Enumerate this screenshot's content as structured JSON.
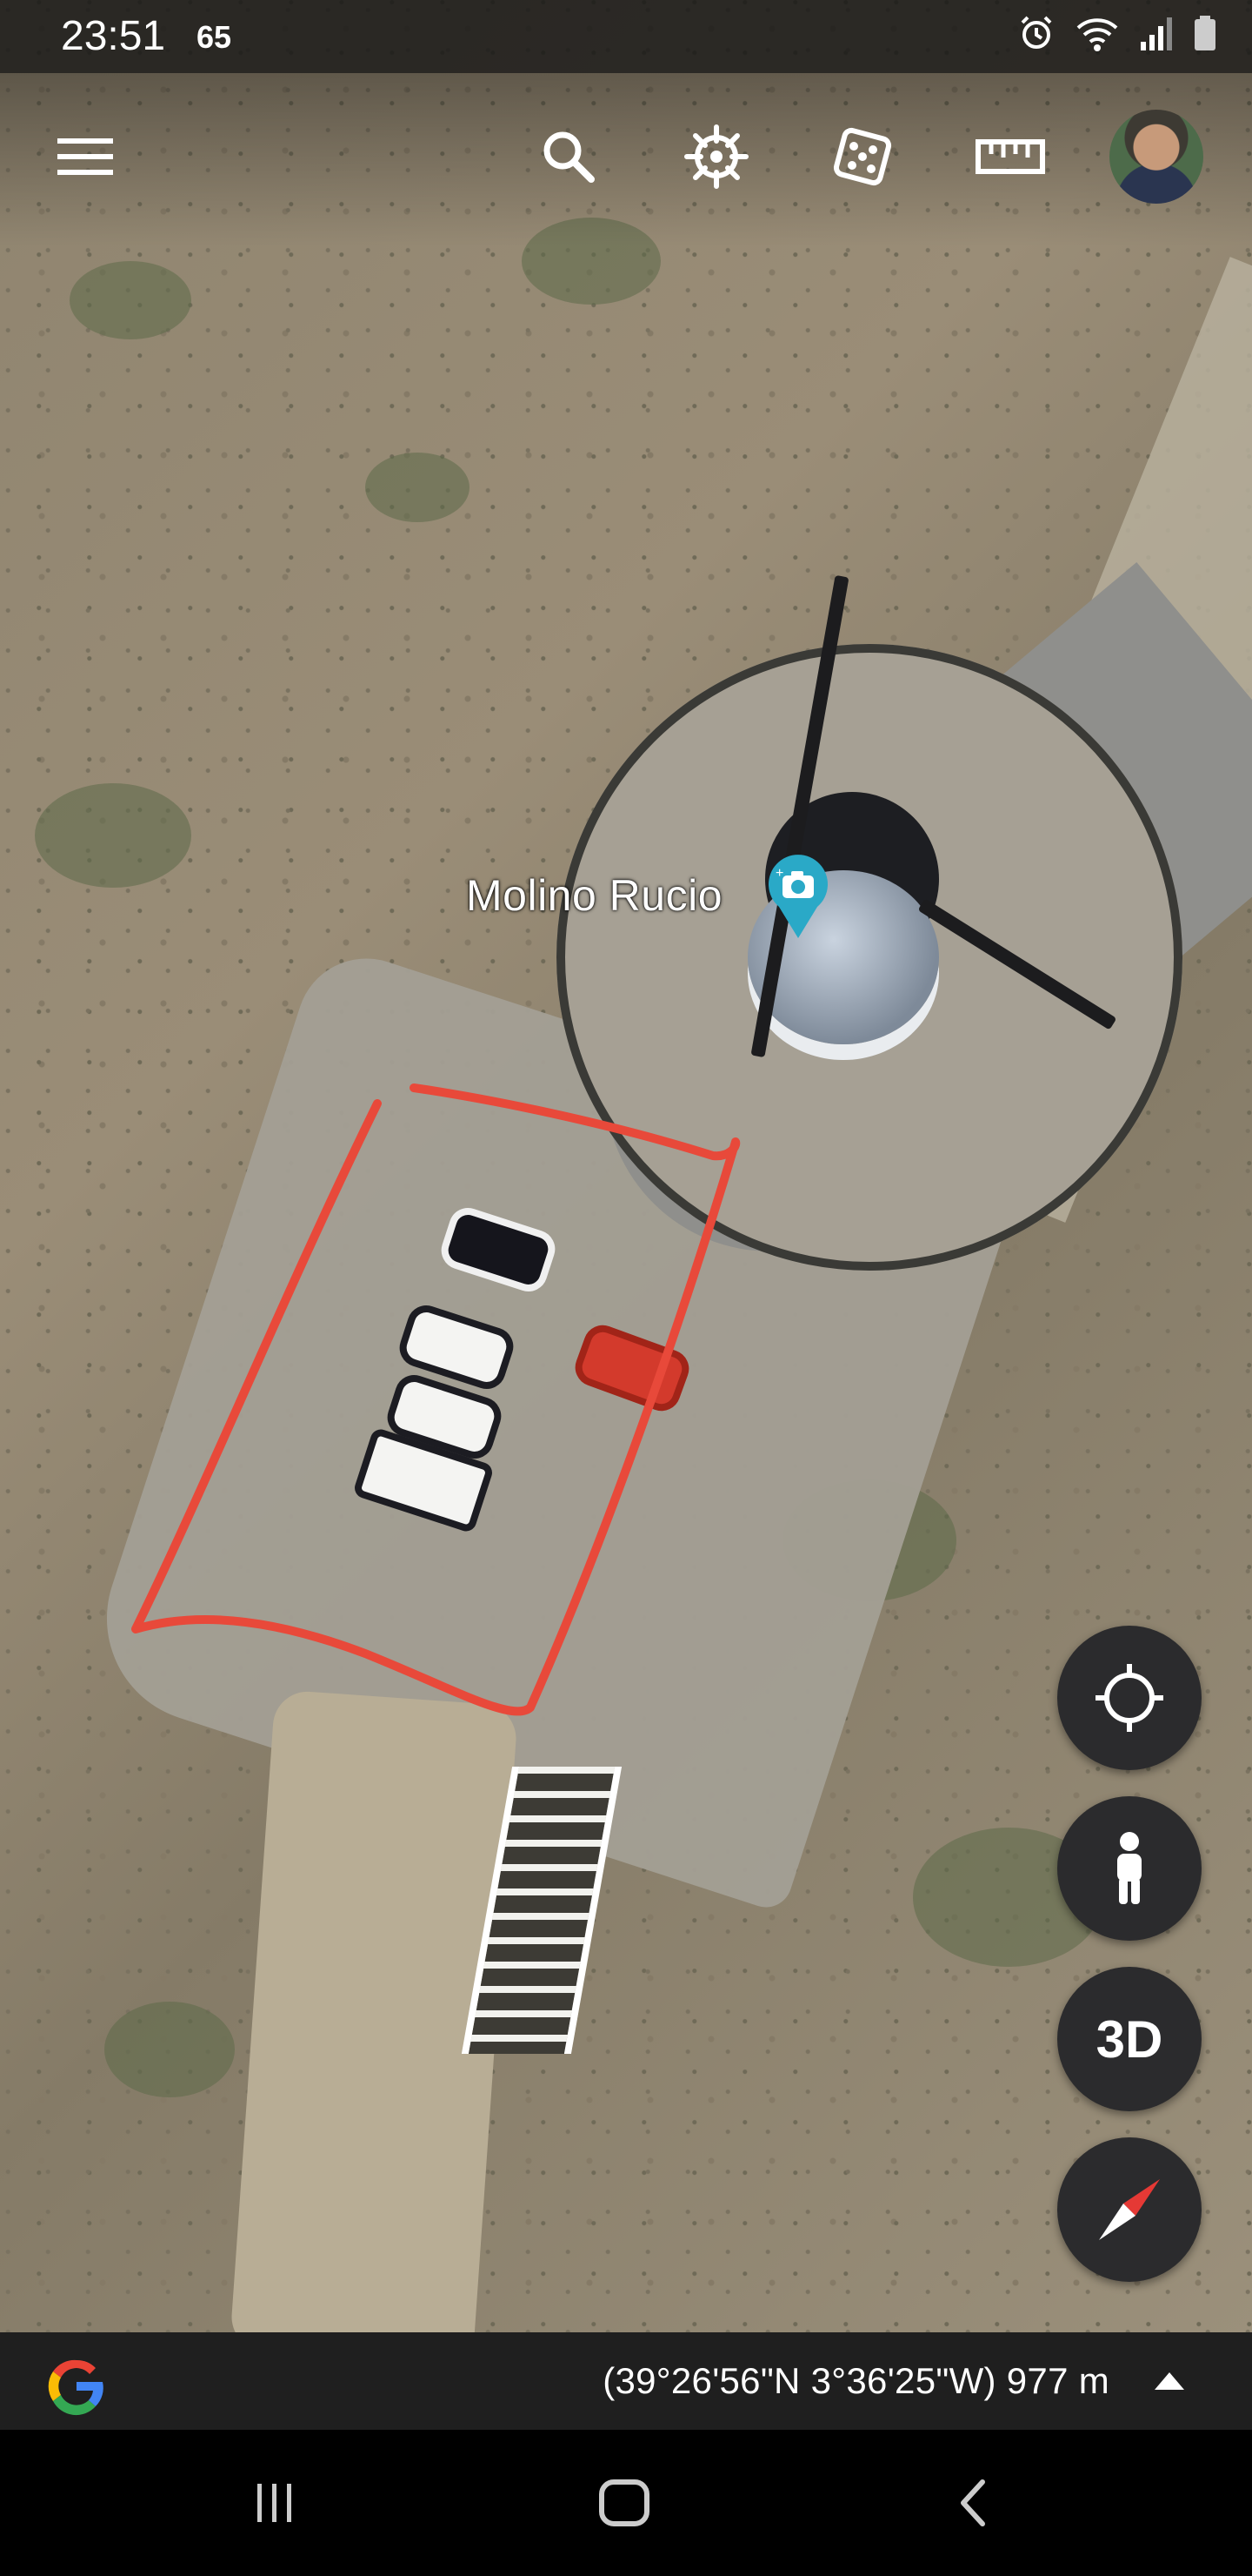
{
  "status_bar": {
    "time": "23:51",
    "extra_indicator": "65",
    "icons": [
      "alarm-icon",
      "wifi-icon",
      "signal-icon",
      "battery-icon"
    ]
  },
  "toolbar": {
    "items": [
      "menu-icon",
      "search-icon",
      "voyager-wheel-icon",
      "dice-icon",
      "ruler-icon",
      "avatar"
    ]
  },
  "map": {
    "place_label": "Molino Rucio",
    "place_pin_icon": "photo-camera-pin-icon",
    "annotation_color": "#e8493a"
  },
  "controls": {
    "my_location_icon": "crosshair-icon",
    "street_view_icon": "pegman-icon",
    "three_d_label": "3D",
    "compass_icon": "compass-icon"
  },
  "info_bar": {
    "logo": "google-g-logo",
    "coordinates": "(39°26'56\"N 3°36'25\"W) 977 m",
    "expand_icon": "chevron-up-icon"
  },
  "nav_bar": {
    "buttons": [
      "recent-apps-icon",
      "home-icon",
      "back-icon"
    ]
  },
  "colors": {
    "status_bar_bg": "#141414",
    "fab_bg": "#2b2b2d",
    "info_bar_bg": "#1f1f1f",
    "pin_color": "#2aa9c7"
  }
}
